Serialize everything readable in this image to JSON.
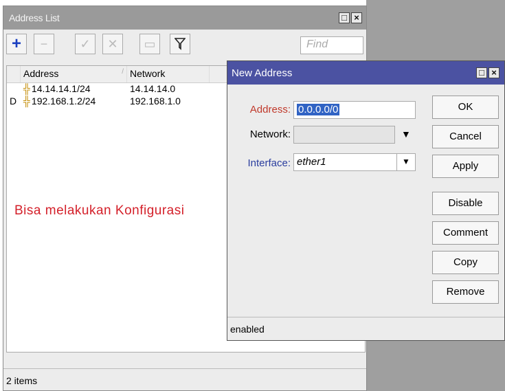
{
  "address_list": {
    "title": "Address List",
    "find_placeholder": "Find",
    "columns": {
      "flag": "",
      "address": "Address",
      "network": "Network"
    },
    "rows": [
      {
        "flag": "",
        "address": "14.14.14.1/24",
        "network": "14.14.14.0"
      },
      {
        "flag": "D",
        "address": "192.168.1.2/24",
        "network": "192.168.1.0"
      }
    ],
    "annotation": "Bisa melakukan Konfigurasi",
    "status": "2 items"
  },
  "dialog": {
    "title": "New Address",
    "address_label": "Address:",
    "address_value": "0.0.0.0/0",
    "network_label": "Network:",
    "network_value": "",
    "interface_label": "Interface:",
    "interface_value": "ether1",
    "buttons": {
      "ok": "OK",
      "cancel": "Cancel",
      "apply": "Apply",
      "disable": "Disable",
      "comment": "Comment",
      "copy": "Copy",
      "remove": "Remove"
    },
    "status": "enabled"
  },
  "icons": {
    "add": "plus-icon",
    "remove": "minus-icon",
    "enable": "check-icon",
    "disable": "cross-icon",
    "comment": "comment-icon",
    "filter": "filter-icon",
    "ip": "ip-address-icon",
    "maximize": "maximize-icon",
    "close": "close-icon",
    "dropdown": "dropdown-arrow-icon"
  },
  "colors": {
    "dialog_title": "#4b52a2",
    "address_label": "#c0392b",
    "interface_label": "#2a3d9e",
    "annotation": "#d4202a",
    "selection": "#3063c4"
  }
}
